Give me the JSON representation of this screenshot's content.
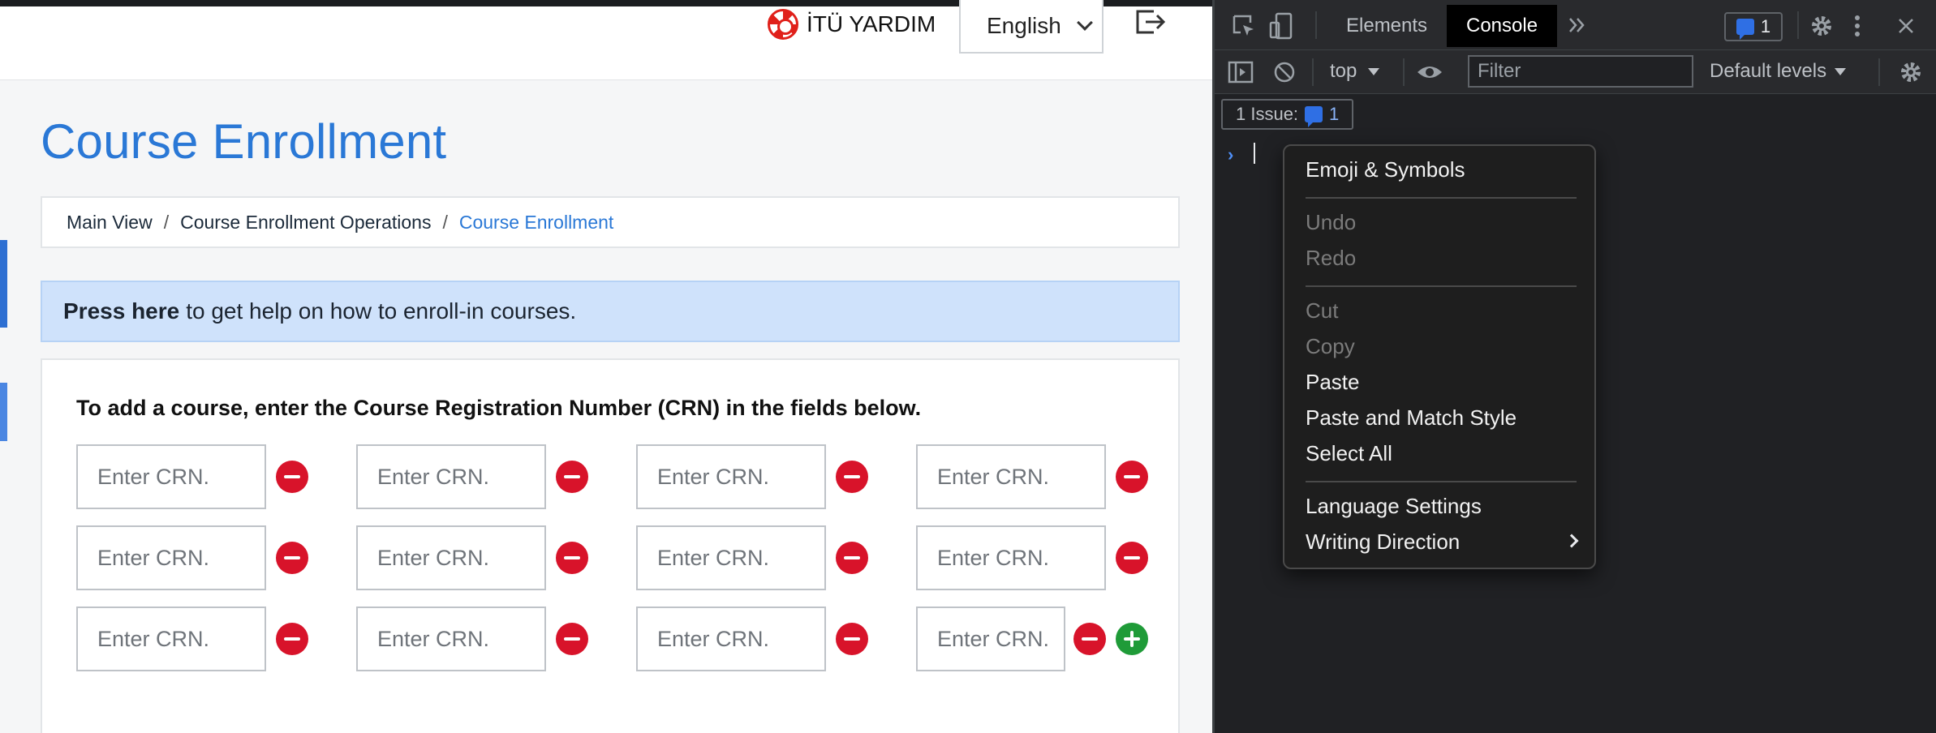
{
  "header": {
    "help_label": "İTÜ YARDIM",
    "language": "English"
  },
  "page": {
    "title": "Course Enrollment",
    "breadcrumb": [
      "Main View",
      "Course Enrollment Operations",
      "Course Enrollment"
    ],
    "alert": {
      "link_text": "Press here",
      "rest_text": "to get help on how to enroll-in courses."
    },
    "card": {
      "heading": "To add a course, enter the Course Registration Number (CRN) in the fields below.",
      "placeholder": "Enter CRN.",
      "rows": 3,
      "cols": 4
    }
  },
  "devtools": {
    "tabs": [
      "Elements",
      "Console"
    ],
    "active_tab": "Console",
    "issue_count": "1",
    "context": "top",
    "filter_placeholder": "Filter",
    "levels": "Default levels",
    "issues_label": "1 Issue:",
    "issues_count": "1"
  },
  "context_menu": {
    "groups": [
      [
        {
          "label": "Emoji & Symbols",
          "enabled": true
        }
      ],
      [
        {
          "label": "Undo",
          "enabled": false
        },
        {
          "label": "Redo",
          "enabled": false
        }
      ],
      [
        {
          "label": "Cut",
          "enabled": false
        },
        {
          "label": "Copy",
          "enabled": false
        },
        {
          "label": "Paste",
          "enabled": true
        },
        {
          "label": "Paste and Match Style",
          "enabled": true
        },
        {
          "label": "Select All",
          "enabled": true
        }
      ],
      [
        {
          "label": "Language Settings",
          "enabled": true
        },
        {
          "label": "Writing Direction",
          "enabled": true,
          "submenu": true
        }
      ]
    ]
  },
  "colors": {
    "accent": "#2a78d6",
    "remove": "#d8132a",
    "add": "#1f9b38",
    "alert_bg": "#cfe2fb"
  }
}
